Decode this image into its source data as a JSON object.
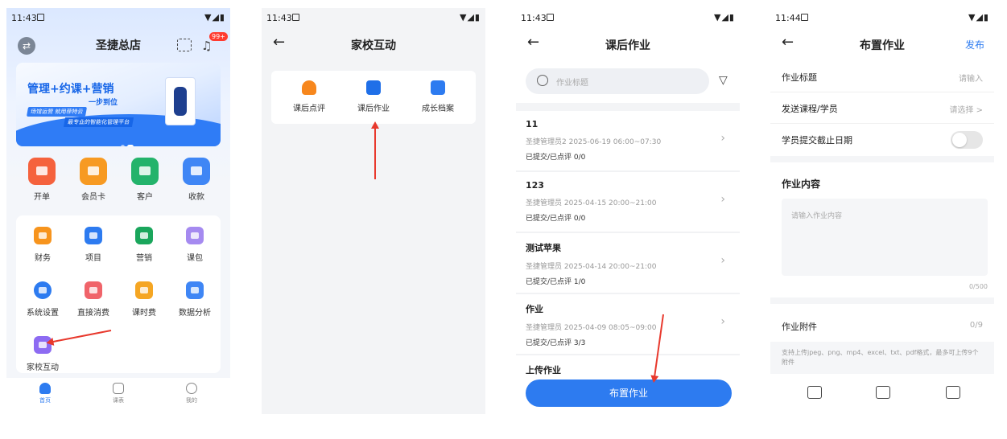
{
  "screen1": {
    "status": {
      "time": "11:43"
    },
    "title": "圣捷总店",
    "badge": "99+",
    "banner": {
      "line1": "管理+约课+营销",
      "line2": "一步到位",
      "line3": "场馆运营 就用菲特云",
      "line4": "最专业的智能化管理平台"
    },
    "quick": [
      {
        "label": "开单",
        "color": "#f5623d"
      },
      {
        "label": "会员卡",
        "color": "#f79a22"
      },
      {
        "label": "客户",
        "color": "#24b36b"
      },
      {
        "label": "收款",
        "color": "#3f86f5"
      }
    ],
    "grid": [
      {
        "label": "财务",
        "color": "#f7941d"
      },
      {
        "label": "项目",
        "color": "#2d7bf0"
      },
      {
        "label": "营销",
        "color": "#1aa65c"
      },
      {
        "label": "课包",
        "color": "#a58af0"
      },
      {
        "label": "系统设置",
        "color": "#2d7bf0"
      },
      {
        "label": "直接消费",
        "color": "#f0646a"
      },
      {
        "label": "课时费",
        "color": "#f5a623"
      },
      {
        "label": "数据分析",
        "color": "#3f86f5"
      },
      {
        "label": "家校互动",
        "color": "#8d6bf2"
      }
    ],
    "tabs": [
      {
        "label": "首页"
      },
      {
        "label": "课表"
      },
      {
        "label": "我的"
      }
    ]
  },
  "screen2": {
    "status": {
      "time": "11:43"
    },
    "title": "家校互动",
    "features": [
      {
        "label": "课后点评",
        "color": "#f7871d"
      },
      {
        "label": "课后作业",
        "color": "#1f6fe8"
      },
      {
        "label": "成长档案",
        "color": "#2d7bf0"
      }
    ]
  },
  "screen3": {
    "status": {
      "time": "11:43"
    },
    "title": "课后作业",
    "search_placeholder": "作业标题",
    "items": [
      {
        "title": "11",
        "meta": "圣捷管理员2  2025-06-19 06:00~07:30",
        "stat": "已提交/已点评 0/0"
      },
      {
        "title": "123",
        "meta": "圣捷管理员  2025-04-15 20:00~21:00",
        "stat": "已提交/已点评 0/0"
      },
      {
        "title": "测试苹果",
        "meta": "圣捷管理员  2025-04-14 20:00~21:00",
        "stat": "已提交/已点评 1/0"
      },
      {
        "title": "作业",
        "meta": "圣捷管理员  2025-04-09 08:05~09:00",
        "stat": "已提交/已点评 3/3"
      },
      {
        "title": "上传作业",
        "meta": "",
        "stat": ""
      }
    ],
    "button": "布置作业"
  },
  "screen4": {
    "status": {
      "time": "11:44"
    },
    "title": "布置作业",
    "publish": "发布",
    "rows": {
      "title_label": "作业标题",
      "title_value": "请输入",
      "course_label": "发送课程/学员",
      "course_value": "请选择 >",
      "deadline_label": "学员提交截止日期"
    },
    "content_title": "作业内容",
    "content_placeholder": "请输入作业内容",
    "content_count": "0/500",
    "attach_label": "作业附件",
    "attach_count": "0/9",
    "attach_hint": "支持上传jpeg、png、mp4、excel、txt、pdf格式，最多可上传9个附件"
  }
}
